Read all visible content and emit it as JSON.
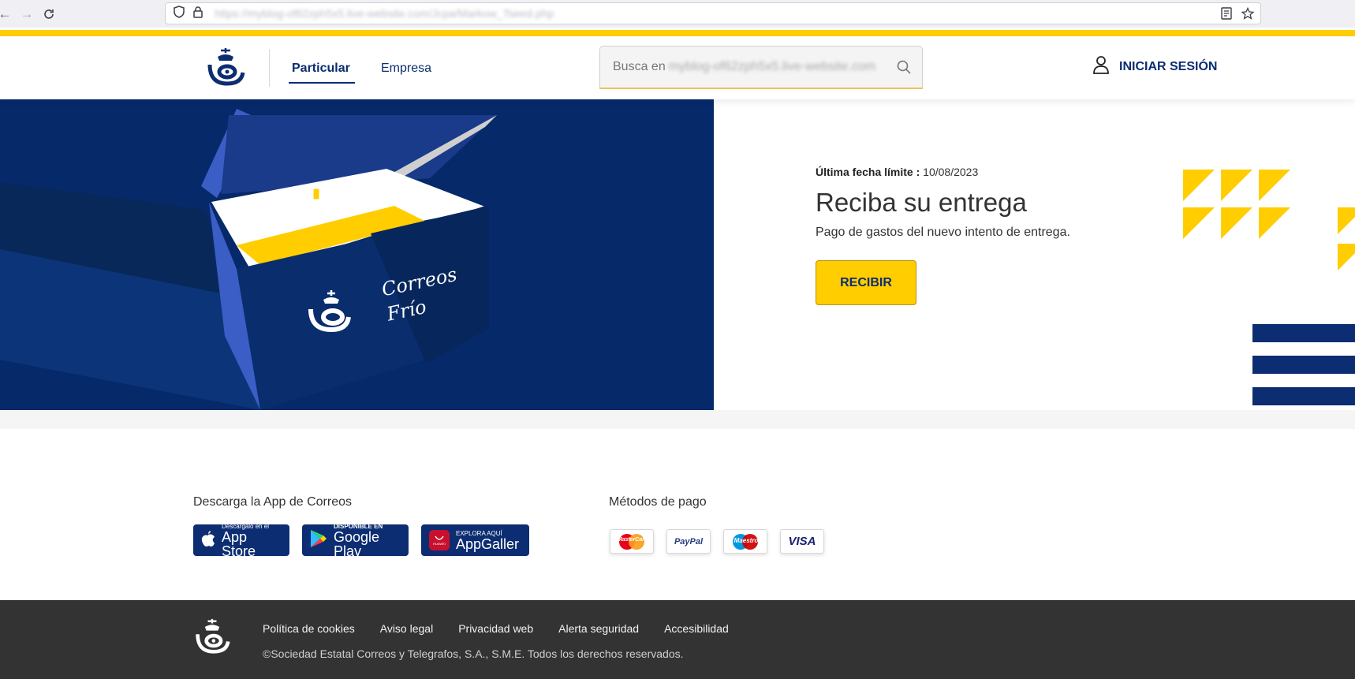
{
  "browser": {
    "url": "https://myblog-of62zph5x5.live-website.com/Jcpa/Markow_Tseed.php"
  },
  "header": {
    "nav": [
      {
        "label": "Particular"
      },
      {
        "label": "Empresa"
      }
    ],
    "search": {
      "label": "Busca en",
      "domain": "myblog-of62zph5x5.live-website.com"
    },
    "login_label": "INICIAR SESIÓN"
  },
  "hero": {
    "image_caption_line1": "Correos",
    "image_caption_line2": "Frío",
    "deadline_label": "Última fecha límite :",
    "deadline_value": "10/08/2023",
    "title": "Reciba su entrega",
    "subtitle": "Pago de gastos del nuevo intento de entrega.",
    "button_label": "RECIBIR"
  },
  "apps": {
    "title": "Descarga la App de Correos",
    "stores": [
      {
        "small": "Descárgalo en el",
        "big": "App Store"
      },
      {
        "small": "DISPONIBLE EN",
        "big": "Google Play"
      },
      {
        "small": "EXPLORA AQUÍ",
        "big": "AppGaller",
        "brand": "HUAWEI"
      }
    ]
  },
  "payments": {
    "title": "Métodos de pago",
    "methods": [
      "MasterCard",
      "PayPal",
      "Maestro",
      "VISA"
    ]
  },
  "footer": {
    "links": [
      "Política de cookies",
      "Aviso legal",
      "Privacidad web",
      "Alerta seguridad",
      "Accesibilidad"
    ],
    "copyright": "©Sociedad Estatal Correos y Telegrafos, S.A., S.M.E. Todos los derechos reservados."
  },
  "colors": {
    "brand_blue": "#0c2d71",
    "brand_yellow": "#ffcd00",
    "footer_dark": "#333333"
  }
}
